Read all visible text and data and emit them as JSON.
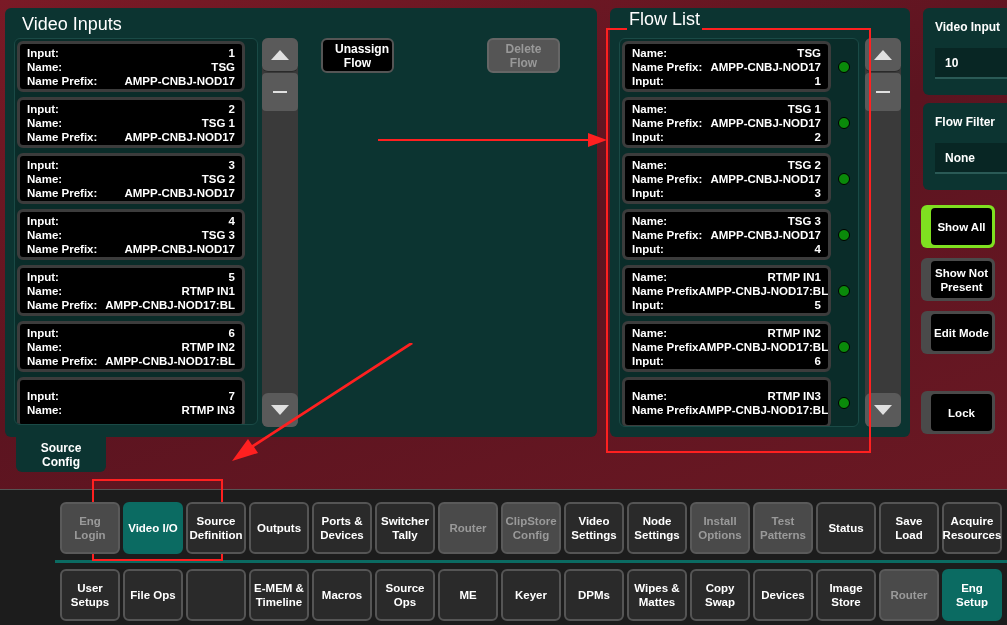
{
  "video_inputs": {
    "title": "Video Inputs",
    "cards": [
      {
        "rows": [
          {
            "label": "Input:",
            "value": "1"
          },
          {
            "label": "Name:",
            "value": "TSG"
          },
          {
            "label": "Name Prefix:",
            "value": "AMPP-CNBJ-NOD17"
          }
        ]
      },
      {
        "rows": [
          {
            "label": "Input:",
            "value": "2"
          },
          {
            "label": "Name:",
            "value": "TSG 1"
          },
          {
            "label": "Name Prefix:",
            "value": "AMPP-CNBJ-NOD17"
          }
        ]
      },
      {
        "rows": [
          {
            "label": "Input:",
            "value": "3"
          },
          {
            "label": "Name:",
            "value": "TSG 2"
          },
          {
            "label": "Name Prefix:",
            "value": "AMPP-CNBJ-NOD17"
          }
        ]
      },
      {
        "rows": [
          {
            "label": "Input:",
            "value": "4"
          },
          {
            "label": "Name:",
            "value": "TSG 3"
          },
          {
            "label": "Name Prefix:",
            "value": "AMPP-CNBJ-NOD17"
          }
        ]
      },
      {
        "rows": [
          {
            "label": "Input:",
            "value": "5"
          },
          {
            "label": "Name:",
            "value": "RTMP IN1"
          },
          {
            "label": "Name Prefix:",
            "value": "AMPP-CNBJ-NOD17:BL"
          }
        ]
      },
      {
        "rows": [
          {
            "label": "Input:",
            "value": "6"
          },
          {
            "label": "Name:",
            "value": "RTMP IN2"
          },
          {
            "label": "Name Prefix:",
            "value": "AMPP-CNBJ-NOD17:BL"
          }
        ]
      },
      {
        "rows": [
          {
            "label": "Input:",
            "value": "7"
          },
          {
            "label": "Name:",
            "value": "RTMP IN3"
          }
        ]
      }
    ],
    "buttons": [
      {
        "label": "Unassign Flow",
        "disabled": false
      },
      {
        "label": "Delete Flow",
        "disabled": true
      }
    ],
    "tab": "Source Config"
  },
  "flow_list": {
    "title": "Flow List",
    "cards": [
      {
        "present": true,
        "rows": [
          {
            "label": "Name:",
            "value": "TSG"
          },
          {
            "label": "Name Prefix:",
            "value": "AMPP-CNBJ-NOD17"
          },
          {
            "label": "Input:",
            "value": "1"
          }
        ]
      },
      {
        "present": true,
        "rows": [
          {
            "label": "Name:",
            "value": "TSG 1"
          },
          {
            "label": "Name Prefix:",
            "value": "AMPP-CNBJ-NOD17"
          },
          {
            "label": "Input:",
            "value": "2"
          }
        ]
      },
      {
        "present": true,
        "rows": [
          {
            "label": "Name:",
            "value": "TSG 2"
          },
          {
            "label": "Name Prefix:",
            "value": "AMPP-CNBJ-NOD17"
          },
          {
            "label": "Input:",
            "value": "3"
          }
        ]
      },
      {
        "present": true,
        "rows": [
          {
            "label": "Name:",
            "value": "TSG 3"
          },
          {
            "label": "Name Prefix:",
            "value": "AMPP-CNBJ-NOD17"
          },
          {
            "label": "Input:",
            "value": "4"
          }
        ]
      },
      {
        "present": true,
        "rows": [
          {
            "label": "Name:",
            "value": "RTMP IN1"
          },
          {
            "label": "Name Prefix",
            "value": "AMPP-CNBJ-NOD17:BL"
          },
          {
            "label": "Input:",
            "value": "5"
          }
        ]
      },
      {
        "present": true,
        "rows": [
          {
            "label": "Name:",
            "value": "RTMP IN2"
          },
          {
            "label": "Name Prefix",
            "value": "AMPP-CNBJ-NOD17:BL"
          },
          {
            "label": "Input:",
            "value": "6"
          }
        ]
      },
      {
        "present": true,
        "rows": [
          {
            "label": "Name:",
            "value": "RTMP IN3"
          },
          {
            "label": "Name Prefix",
            "value": "AMPP-CNBJ-NOD17:BL"
          }
        ]
      }
    ]
  },
  "side": {
    "fields": [
      {
        "label": "Video Input",
        "value": "10"
      },
      {
        "label": "Flow Filter",
        "value": "None"
      }
    ],
    "buttons": [
      {
        "label": "Show All",
        "selected": true
      },
      {
        "label": "Show Not Present",
        "selected": false
      },
      {
        "label": "Edit Mode",
        "selected": false
      },
      {
        "label": "Lock",
        "selected": false
      }
    ]
  },
  "menu_rows": [
    [
      {
        "label": "Eng Login",
        "disabled": true,
        "selected": false
      },
      {
        "label": "Video I/O",
        "disabled": false,
        "selected": true
      },
      {
        "label": "Source Definition",
        "disabled": false,
        "selected": false
      },
      {
        "label": "Outputs",
        "disabled": false,
        "selected": false
      },
      {
        "label": "Ports & Devices",
        "disabled": false,
        "selected": false
      },
      {
        "label": "Switcher Tally",
        "disabled": false,
        "selected": false
      },
      {
        "label": "Router",
        "disabled": true,
        "selected": false
      },
      {
        "label": "ClipStore Config",
        "disabled": true,
        "selected": false
      },
      {
        "label": "Video Settings",
        "disabled": false,
        "selected": false
      },
      {
        "label": "Node Settings",
        "disabled": false,
        "selected": false
      },
      {
        "label": "Install Options",
        "disabled": true,
        "selected": false
      },
      {
        "label": "Test Patterns",
        "disabled": true,
        "selected": false
      },
      {
        "label": "Status",
        "disabled": false,
        "selected": false
      },
      {
        "label": "Save Load",
        "disabled": false,
        "selected": false
      },
      {
        "label": "Acquire Resources",
        "disabled": false,
        "selected": false
      }
    ],
    [
      {
        "label": "User Setups",
        "disabled": false,
        "selected": false
      },
      {
        "label": "File Ops",
        "disabled": false,
        "selected": false
      },
      {
        "disabled": false,
        "selected": false
      },
      {
        "label": "E-MEM & Timeline",
        "disabled": false,
        "selected": false
      },
      {
        "label": "Macros",
        "disabled": false,
        "selected": false
      },
      {
        "label": "Source Ops",
        "disabled": false,
        "selected": false
      },
      {
        "label": "ME",
        "disabled": false,
        "selected": false
      },
      {
        "label": "Keyer",
        "disabled": false,
        "selected": false
      },
      {
        "label": "DPMs",
        "disabled": false,
        "selected": false
      },
      {
        "label": "Wipes & Mattes",
        "disabled": false,
        "selected": false
      },
      {
        "label": "Copy Swap",
        "disabled": false,
        "selected": false
      },
      {
        "label": "Devices",
        "disabled": false,
        "selected": false
      },
      {
        "label": "Image Store",
        "disabled": false,
        "selected": false
      },
      {
        "label": "Router",
        "disabled": true,
        "selected": false
      },
      {
        "label": "Eng Setup",
        "disabled": false,
        "selected": true
      }
    ]
  ]
}
